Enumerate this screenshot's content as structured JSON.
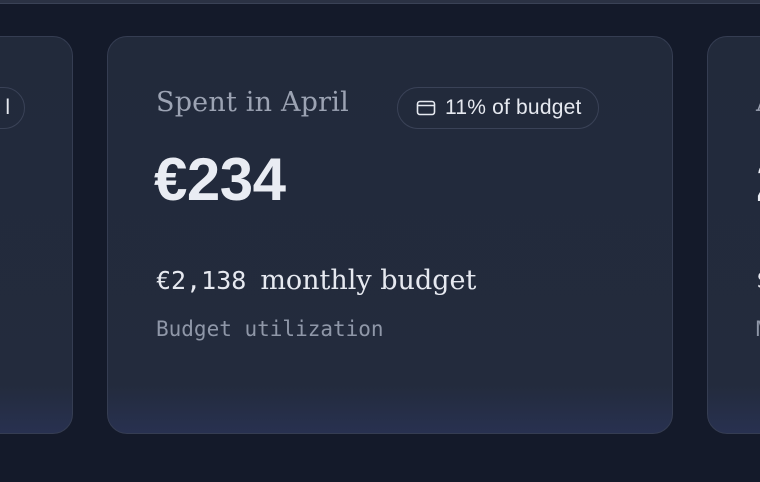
{
  "cards": {
    "main": {
      "title": "Spent in April",
      "badge_icon": "wallet-icon",
      "badge_text": "11% of budget",
      "amount": "€234",
      "budget_amount": "€2,138",
      "budget_label": "monthly budget",
      "utilization_label": "Budget utilization"
    },
    "left": {
      "badge_fragment": "l"
    },
    "right": {
      "title_fragment": "A",
      "amount_fragment": "2",
      "budget_fragment": "$",
      "utilization_fragment": "M"
    }
  },
  "colors": {
    "background": "#141a2a",
    "card": "#222a3b",
    "border": "#353d52",
    "text_primary": "#e6e9f0",
    "text_muted": "#9ca3b3"
  }
}
